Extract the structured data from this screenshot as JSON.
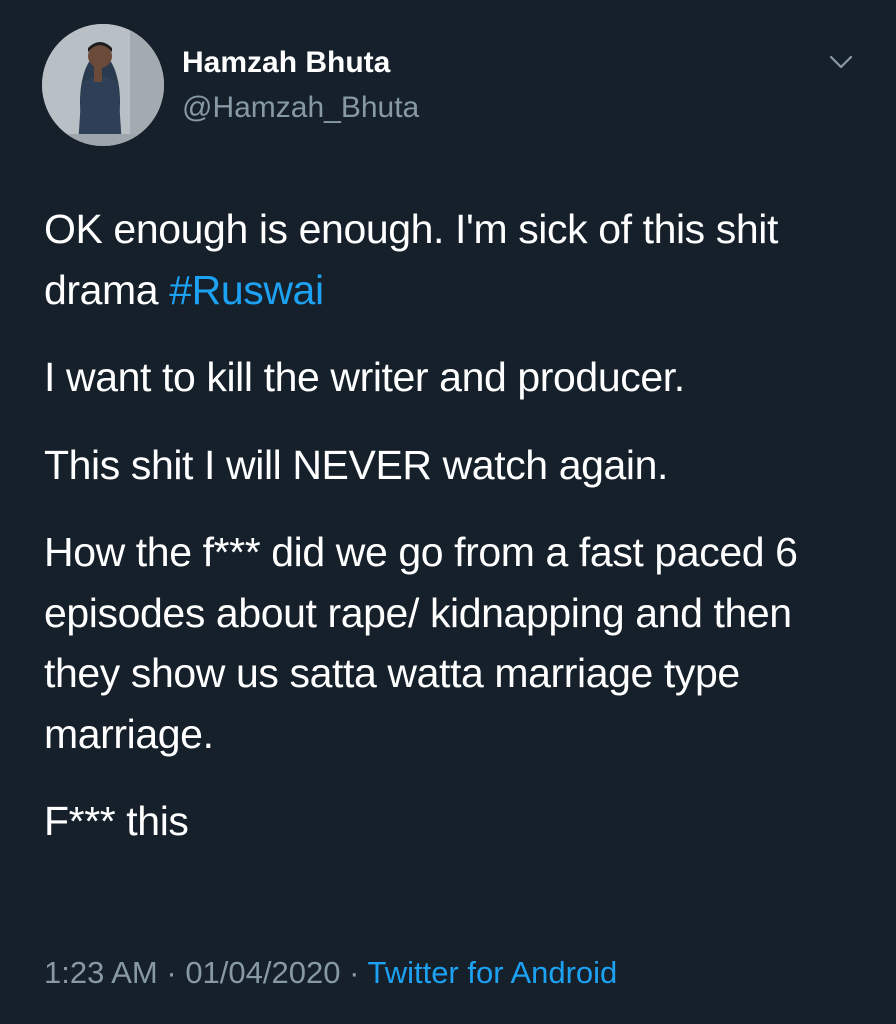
{
  "author": {
    "display_name": "Hamzah Bhuta",
    "handle": "@Hamzah_Bhuta",
    "avatar_icon": "profile-photo"
  },
  "menu": {
    "icon": "chevron-down-icon"
  },
  "tweet": {
    "line1_text": "OK enough is enough. I'm sick of this shit drama ",
    "hashtag": "#Ruswai",
    "p2": "I want to kill the writer and producer.",
    "p3": "This shit I will NEVER watch again.",
    "p4": "How the f*** did we go from a fast paced 6 episodes about rape/ kidnapping and then they show us satta watta marriage type marriage.",
    "p5": "F*** this"
  },
  "meta": {
    "time": "1:23 AM",
    "separator1": " · ",
    "date": "01/04/2020",
    "separator2": " · ",
    "source": "Twitter for Android"
  },
  "colors": {
    "background": "#15202b",
    "text": "#ffffff",
    "secondary_text": "#8899a6",
    "link": "#1da1f2"
  }
}
